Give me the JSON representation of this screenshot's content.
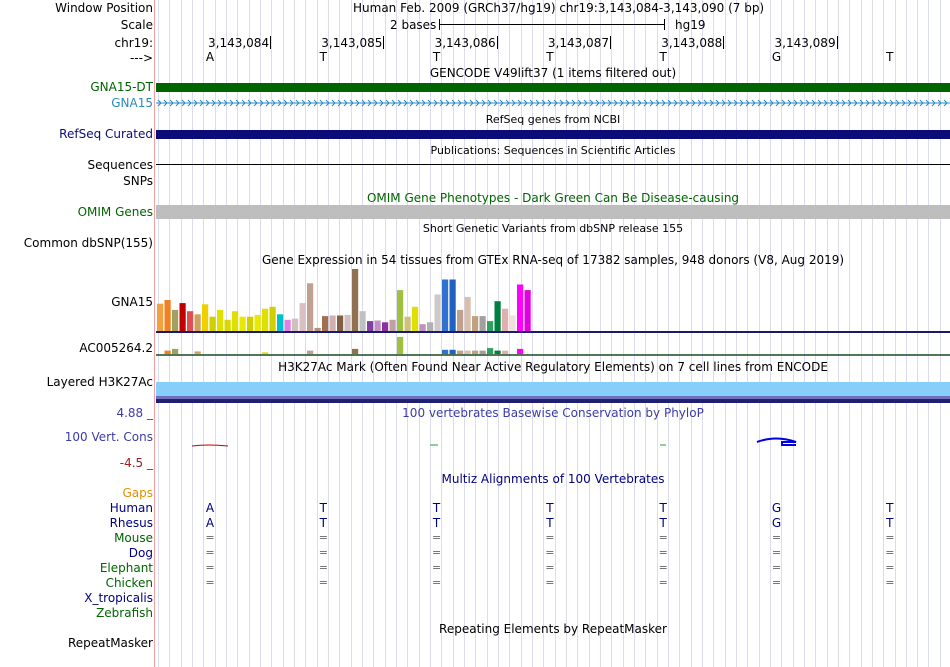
{
  "labels": {
    "window_position": "Window Position",
    "scale": "Scale",
    "chrom": "chr19:",
    "strand": "--->",
    "gna15dt": "GNA15-DT",
    "gna15": "GNA15",
    "refseq": "RefSeq Curated",
    "sequences": "Sequences",
    "snps": "SNPs",
    "omim": "OMIM Genes",
    "dbsnp": "Common dbSNP(155)",
    "gtex_gene1": "GNA15",
    "gtex_gene2": "AC005264.2",
    "h3k27ac": "Layered H3K27Ac",
    "cons_max": "4.88 _",
    "cons": "100 Vert. Cons",
    "cons_min": "-4.5 _",
    "gaps": "Gaps",
    "repeatmasker": "RepeatMasker"
  },
  "header": {
    "position_text": "Human Feb. 2009 (GRCh37/hg19)   chr19:3,143,084-3,143,090 (7 bp)",
    "scale_text": "2 bases",
    "assembly": "hg19",
    "coords": [
      "3,143,084",
      "3,143,085",
      "3,143,086",
      "3,143,087",
      "3,143,088",
      "3,143,089"
    ],
    "bases": [
      "A",
      "T",
      "T",
      "T",
      "T",
      "G",
      "T"
    ]
  },
  "tracks": {
    "gencode_title": "GENCODE V49lift37 (1 items filtered out)",
    "refseq_title": "RefSeq genes from NCBI",
    "publications_title": "Publications: Sequences in Scientific Articles",
    "omim_title": "OMIM Gene Phenotypes - Dark Green Can Be Disease-causing",
    "dbsnp_title": "Short Genetic Variants from dbSNP release 155",
    "gtex_title": "Gene Expression in 54 tissues from GTEx RNA-seq of 17382 samples, 948 donors (V8, Aug 2019)",
    "h3k27ac_title": "H3K27Ac Mark (Often Found Near Active Regulatory Elements) on 7 cell lines from ENCODE",
    "phylop_title": "100 vertebrates Basewise Conservation by PhyloP",
    "multiz_title": "Multiz Alignments of 100 Vertebrates",
    "repeat_title": "Repeating Elements by RepeatMasker"
  },
  "alignment": {
    "species": [
      {
        "name": "Human",
        "row": [
          "A",
          "T",
          "T",
          "T",
          "T",
          "G",
          "T"
        ],
        "color": "#000080"
      },
      {
        "name": "Rhesus",
        "row": [
          "A",
          "T",
          "T",
          "T",
          "T",
          "G",
          "T"
        ],
        "color": "#000080"
      },
      {
        "name": "Mouse",
        "row": [
          "=",
          "=",
          "=",
          "=",
          "=",
          "=",
          "="
        ],
        "color": "#006400"
      },
      {
        "name": "Dog",
        "row": [
          "=",
          "=",
          "=",
          "=",
          "=",
          "=",
          "="
        ],
        "color": "#000080"
      },
      {
        "name": "Elephant",
        "row": [
          "=",
          "=",
          "=",
          "=",
          "=",
          "=",
          "="
        ],
        "color": "#006400"
      },
      {
        "name": "Chicken",
        "row": [
          "=",
          "=",
          "=",
          "=",
          "=",
          "=",
          "="
        ],
        "color": "#006400"
      },
      {
        "name": "X_tropicalis",
        "row": [],
        "color": "#000080"
      },
      {
        "name": "Zebrafish",
        "row": [],
        "color": "#006400"
      }
    ]
  },
  "gtex": {
    "gna15_levels": [
      0.44,
      0.5,
      0.34,
      0.45,
      0.32,
      0.27,
      0.43,
      0.23,
      0.34,
      0.18,
      0.32,
      0.23,
      0.23,
      0.26,
      0.36,
      0.39,
      0.27,
      0.18,
      0.2,
      0.45,
      0.77,
      0.05,
      0.24,
      0.25,
      0.25,
      0.26,
      1.0,
      0.32,
      0.16,
      0.17,
      0.14,
      0.18,
      0.66,
      0.23,
      0.39,
      0.11,
      0.14,
      0.59,
      0.83,
      0.83,
      0.34,
      0.55,
      0.24,
      0.24,
      0.16,
      0.48,
      0.36,
      0.25,
      0.75,
      0.66
    ],
    "colors": [
      "#f5a040",
      "#f08020",
      "#a0a060",
      "#c00000",
      "#e05050",
      "#d0a060",
      "#f0d000",
      "#d0d000",
      "#e0e000",
      "#d8d800",
      "#e0e000",
      "#e8e800",
      "#d0d000",
      "#e8e800",
      "#e0e000",
      "#d0d000",
      "#00c0d0",
      "#e080e0",
      "#d0c0c0",
      "#d8c0c0",
      "#c0a090",
      "#b09080",
      "#a07050",
      "#d0b0b0",
      "#806040",
      "#d0c0c0",
      "#907050",
      "#c0c0c0",
      "#8040a0",
      "#c090c0",
      "#9030a0",
      "#c0a0a0",
      "#a0c040",
      "#d0c080",
      "#e0e000",
      "#c090c0",
      "#b0b0b0",
      "#d0c8c8",
      "#3070d0",
      "#2060c0",
      "#c0a090",
      "#d8c0b0",
      "#c0a080",
      "#a0a0a0",
      "#30a060",
      "#008040",
      "#e0b0b0",
      "#f0e0e0",
      "#ff00ff",
      "#e000e0"
    ]
  },
  "colors": {
    "gencode": "#006400",
    "gna15_transcript": "#2a8abf",
    "refseq": "#0c0c78",
    "omim": "#bebebe",
    "h3k27ac": "#87cefa",
    "multiz_title": "#000080",
    "phylop_title": "#3c3ca8",
    "gaps": "#e09000"
  }
}
